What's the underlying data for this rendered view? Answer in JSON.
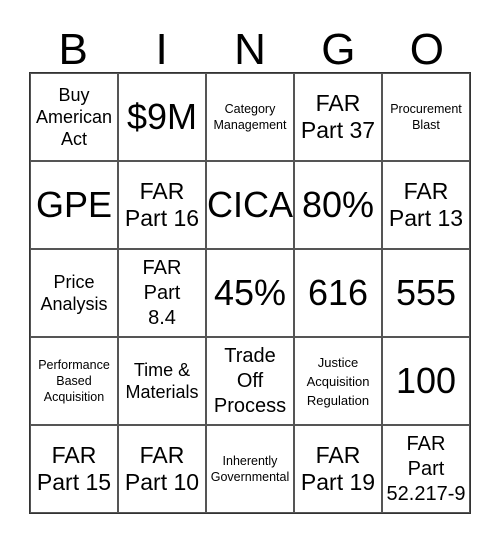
{
  "header": {
    "letters": [
      "B",
      "I",
      "N",
      "G",
      "O"
    ]
  },
  "cells": [
    {
      "text": "Buy\nAmerican\nAct",
      "size": "s-md"
    },
    {
      "text": "$9M",
      "size": "s-xl"
    },
    {
      "text": "Category\nManagement",
      "size": "s-xs"
    },
    {
      "text": "FAR\nPart 37",
      "size": "s-lg"
    },
    {
      "text": "Procurement\nBlast",
      "size": "s-xs"
    },
    {
      "text": "GPE",
      "size": "s-xl"
    },
    {
      "text": "FAR\nPart 16",
      "size": "s-lg"
    },
    {
      "text": "CICA",
      "size": "s-xl"
    },
    {
      "text": "80%",
      "size": "s-xl"
    },
    {
      "text": "FAR\nPart 13",
      "size": "s-lg"
    },
    {
      "text": "Price\nAnalysis",
      "size": "s-md"
    },
    {
      "text": "FAR\nPart\n8.4",
      "size": "s-mid"
    },
    {
      "text": "45%",
      "size": "s-xl"
    },
    {
      "text": "616",
      "size": "s-xl"
    },
    {
      "text": "555",
      "size": "s-xl"
    },
    {
      "text": "Performance\nBased\nAcquisition",
      "size": "s-xs"
    },
    {
      "text": "Time &\nMaterials",
      "size": "s-md"
    },
    {
      "text": "Trade\nOff\nProcess",
      "size": "s-mid"
    },
    {
      "text": "Justice\nAcquisition\nRegulation",
      "size": "s-sm"
    },
    {
      "text": "100",
      "size": "s-xl"
    },
    {
      "text": "FAR\nPart 15",
      "size": "s-lg"
    },
    {
      "text": "FAR\nPart 10",
      "size": "s-lg"
    },
    {
      "text": "Inherently\nGovernmental",
      "size": "s-xs"
    },
    {
      "text": "FAR\nPart 19",
      "size": "s-lg"
    },
    {
      "text": "FAR\nPart\n52.217-9",
      "size": "s-mid"
    }
  ]
}
